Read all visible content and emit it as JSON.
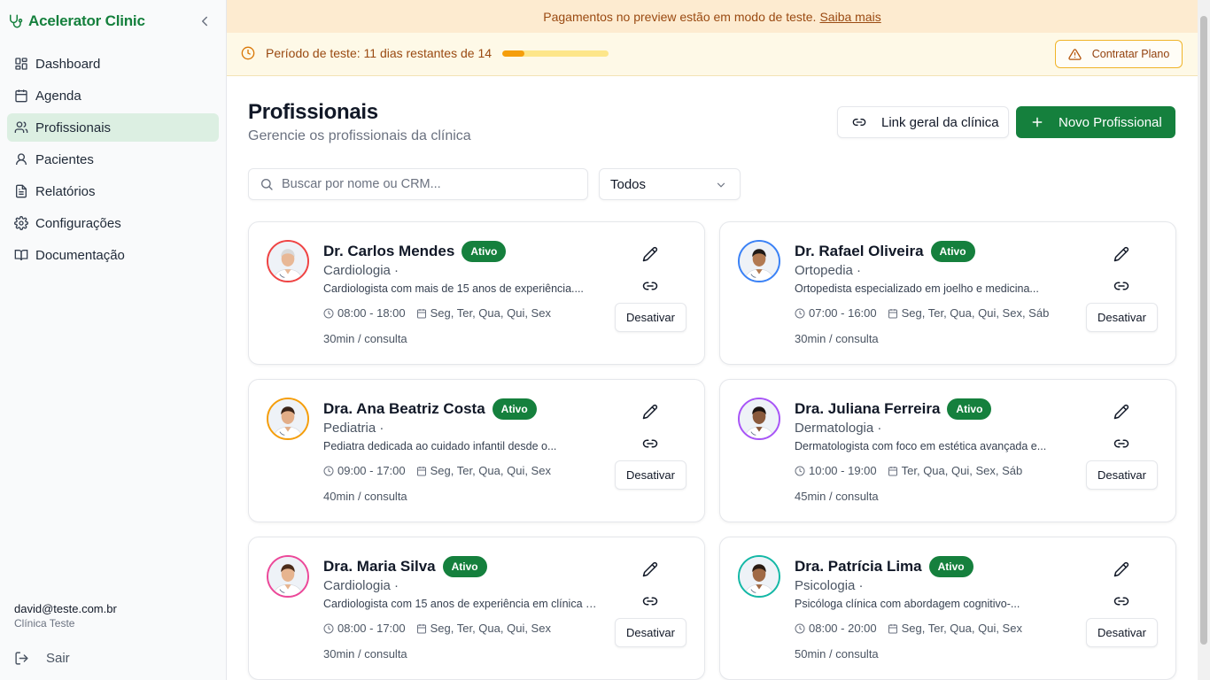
{
  "sidebar": {
    "brand": "Acelerator Clinic",
    "items": [
      {
        "label": "Dashboard",
        "icon": "dashboard-icon"
      },
      {
        "label": "Agenda",
        "icon": "calendar-icon"
      },
      {
        "label": "Profissionais",
        "icon": "users-icon"
      },
      {
        "label": "Pacientes",
        "icon": "user-icon"
      },
      {
        "label": "Relatórios",
        "icon": "file-text-icon"
      },
      {
        "label": "Configurações",
        "icon": "gear-icon"
      },
      {
        "label": "Documentação",
        "icon": "book-icon"
      }
    ],
    "active_item": "Profissionais",
    "user_email": "david@teste.com.br",
    "clinic_name": "Clínica Teste",
    "logout_label": "Sair"
  },
  "banner": {
    "text": "Pagamentos no preview estão em modo de teste.",
    "link": "Saiba mais"
  },
  "trial": {
    "text": "Período de teste: 11 dias restantes de 14",
    "progress_fraction": 0.21,
    "button": "Contratar Plano"
  },
  "header": {
    "title": "Profissionais",
    "subtitle": "Gerencie os profissionais da clínica",
    "link_button": "Link geral da clínica",
    "new_button": "Novo Profissional"
  },
  "filters": {
    "search_placeholder": "Buscar por nome ou CRM...",
    "status_selected": "Todos"
  },
  "cards": [
    {
      "name": "Dr. Carlos Mendes",
      "status": "Ativo",
      "specialty": "Cardiologia ·",
      "description": "Cardiologista com mais de 15 anos de experiência....",
      "hours": "08:00 - 18:00",
      "days": "Seg, Ter, Qua, Qui, Sex",
      "duration": "30min / consulta",
      "deactivate": "Desativar",
      "ring_color": "#ef4444",
      "skin": "#e8b896",
      "hair": "#d9d9d9"
    },
    {
      "name": "Dr. Rafael Oliveira",
      "status": "Ativo",
      "specialty": "Ortopedia ·",
      "description": "Ortopedista especializado em joelho e medicina...",
      "hours": "07:00 - 16:00",
      "days": "Seg, Ter, Qua, Qui, Sex, Sáb",
      "duration": "30min / consulta",
      "deactivate": "Desativar",
      "ring_color": "#3b82f6",
      "skin": "#b27a52",
      "hair": "#1f1a17"
    },
    {
      "name": "Dra. Ana Beatriz Costa",
      "status": "Ativo",
      "specialty": "Pediatria ·",
      "description": "Pediatra dedicada ao cuidado infantil desde o...",
      "hours": "09:00 - 17:00",
      "days": "Seg, Ter, Qua, Qui, Sex",
      "duration": "40min / consulta",
      "deactivate": "Desativar",
      "ring_color": "#f59e0b",
      "skin": "#e2ad87",
      "hair": "#3a2418"
    },
    {
      "name": "Dra. Juliana Ferreira",
      "status": "Ativo",
      "specialty": "Dermatologia ·",
      "description": "Dermatologista com foco em estética avançada e...",
      "hours": "10:00 - 19:00",
      "days": "Ter, Qua, Qui, Sex, Sáb",
      "duration": "45min / consulta",
      "deactivate": "Desativar",
      "ring_color": "#a855f7",
      "skin": "#8a5a3c",
      "hair": "#1c1410"
    },
    {
      "name": "Dra. Maria Silva",
      "status": "Ativo",
      "specialty": "Cardiologia ·",
      "description": "Cardiologista com 15 anos de experiência em clínica e...",
      "hours": "08:00 - 17:00",
      "days": "Seg, Ter, Qua, Qui, Sex",
      "duration": "30min / consulta",
      "deactivate": "Desativar",
      "ring_color": "#ec4899",
      "skin": "#e6b48f",
      "hair": "#4a2c1a"
    },
    {
      "name": "Dra. Patrícia Lima",
      "status": "Ativo",
      "specialty": "Psicologia ·",
      "description": "Psicóloga clínica com abordagem cognitivo-...",
      "hours": "08:00 - 20:00",
      "days": "Seg, Ter, Qua, Qui, Sex",
      "duration": "50min / consulta",
      "deactivate": "Desativar",
      "ring_color": "#14b8a6",
      "skin": "#a06a46",
      "hair": "#2a1a12"
    }
  ]
}
